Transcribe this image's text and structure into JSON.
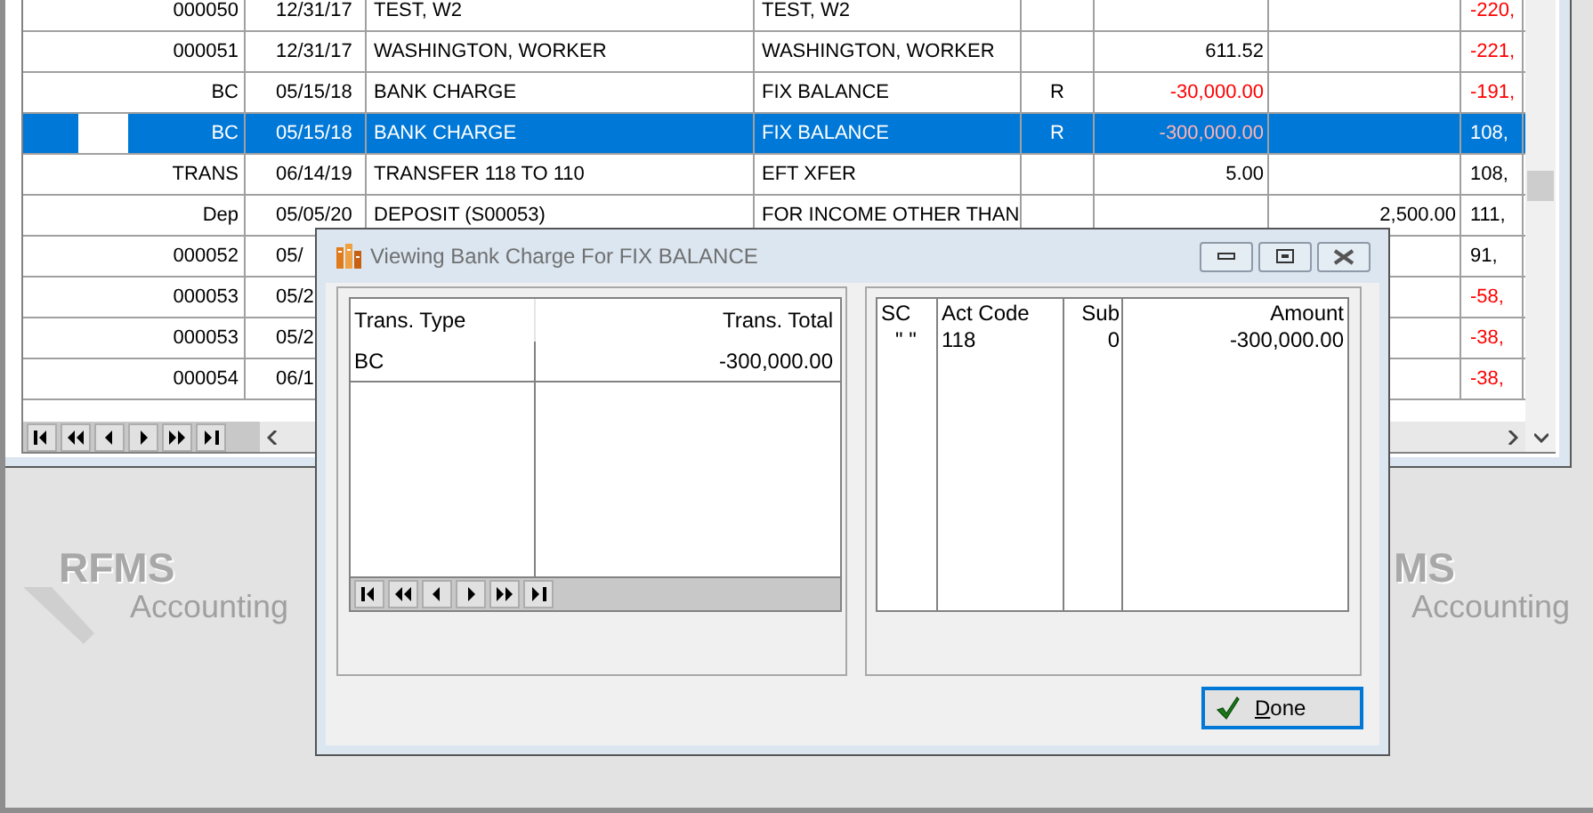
{
  "main_grid": {
    "rows": [
      {
        "ref": "000050",
        "date": "12/31/17",
        "description": "TEST, W2",
        "memo": "TEST, W2",
        "balance": "-220,",
        "balance_negative": true,
        "selected": false
      },
      {
        "ref": "000051",
        "date": "12/31/17",
        "description": "WASHINGTON, WORKER",
        "memo": "WASHINGTON, WORKER",
        "amount": "611.52",
        "balance": "-221,",
        "amount_negative": false,
        "balance_negative": true,
        "selected": false
      },
      {
        "ref": "BC",
        "date": "05/15/18",
        "description": "BANK CHARGE",
        "memo": "FIX BALANCE",
        "flag": "R",
        "amount": "-30,000.00",
        "balance": "-191,",
        "amount_negative": true,
        "balance_negative": true,
        "selected": false
      },
      {
        "ref": "BC",
        "date": "05/15/18",
        "description": "BANK CHARGE",
        "memo": "FIX BALANCE",
        "flag": "R",
        "amount": "-300,000.00",
        "balance": "108,",
        "amount_negative": true,
        "balance_negative": false,
        "selected": true
      },
      {
        "ref": "TRANS",
        "date": "06/14/19",
        "description": "TRANSFER 118 TO 110",
        "memo": "EFT XFER",
        "amount": "5.00",
        "balance": "108,",
        "amount_negative": false,
        "balance_negative": false,
        "selected": false
      },
      {
        "ref": "Dep",
        "date": "05/05/20",
        "description": "DEPOSIT (S00053)",
        "memo": "FOR INCOME OTHER THAN",
        "deposit": "2,500.00",
        "balance": "111,",
        "balance_negative": false,
        "selected": false
      },
      {
        "ref": "000052",
        "date": "05/",
        "balance": "91,",
        "balance_negative": false,
        "selected": false
      },
      {
        "ref": "000053",
        "date": "05/2",
        "balance": "-58,",
        "balance_negative": true,
        "selected": false
      },
      {
        "ref": "000053",
        "date": "05/2",
        "balance": "-38,",
        "balance_negative": true,
        "selected": false
      },
      {
        "ref": "000054",
        "date": "06/1",
        "balance": "-38,",
        "balance_negative": true,
        "selected": false
      }
    ]
  },
  "background_logos": [
    {
      "name": "RFMS",
      "tagline": "Accounting"
    },
    {
      "name": "MS",
      "tagline": "Accounting"
    }
  ],
  "dialog": {
    "title": "Viewing Bank Charge For FIX BALANCE",
    "left_grid": {
      "columns": [
        "Trans. Type",
        "Trans. Total"
      ],
      "rows": [
        {
          "trans_type": "BC",
          "trans_total": "-300,000.00"
        }
      ]
    },
    "right_grid": {
      "columns": [
        "SC",
        "Act Code",
        "Sub",
        "Amount"
      ],
      "rows": [
        {
          "sc": "\" \"",
          "act_code": "118",
          "sub": "0",
          "amount": "-300,000.00"
        }
      ]
    },
    "done_button": {
      "label": "Done"
    }
  }
}
